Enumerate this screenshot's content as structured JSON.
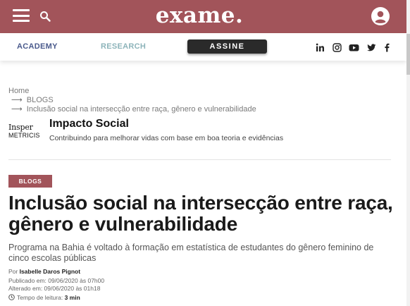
{
  "header": {
    "logo": "exame.",
    "nav": {
      "academy": "ACADEMY",
      "research": "RESEARCH",
      "subscribe": "ASSINE"
    },
    "social_icons": [
      "linkedin-icon",
      "instagram-icon",
      "youtube-icon",
      "twitter-icon",
      "facebook-icon"
    ],
    "colors": {
      "brand": "#a2545a",
      "academy": "#4a5a8c",
      "research": "#8db4ba",
      "button": "#2a2a2a"
    }
  },
  "breadcrumb": {
    "home": "Home",
    "section": "BLOGS",
    "current": "Inclusão social na intersecção entre raça, gênero e vulnerabilidade",
    "arrow": "⟶"
  },
  "blog": {
    "logo_line1": "Insper",
    "logo_line2": "METRICIS",
    "title": "Impacto Social",
    "subtitle": "Contribuindo para melhorar vidas com base em boa teoria e evidências"
  },
  "article": {
    "category": "BLOGS",
    "title": "Inclusão social na intersecção entre raça, gênero e vulnerabilidade",
    "lead": "Programa na Bahia é voltado à formação em estatística de estudantes do gênero feminino de cinco escolas públicas",
    "author_prefix": "Por ",
    "author": "Isabelle Daros Pignot",
    "published": "Publicado em: 09/06/2020 às 07h00",
    "updated": "Alterado em: 09/06/2020 às 01h18",
    "reading_label": "Tempo de leitura: ",
    "reading_time": "3 min"
  }
}
